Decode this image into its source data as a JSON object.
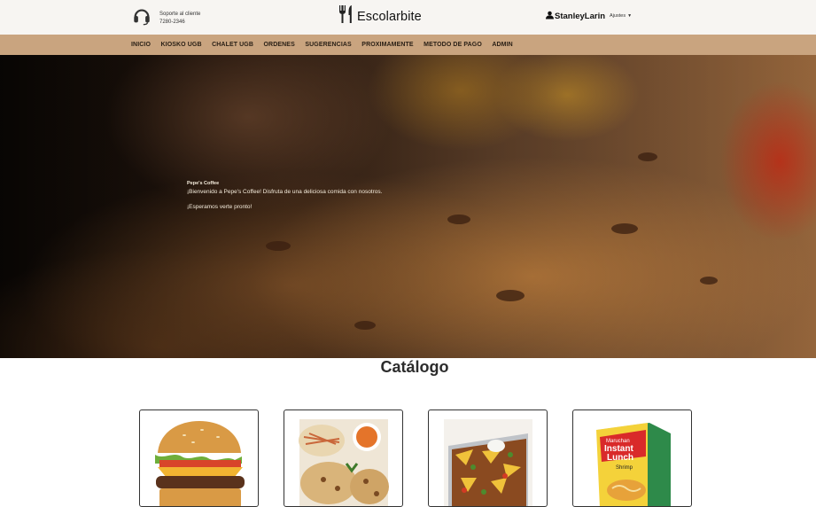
{
  "support": {
    "label": "Soporte al cliente",
    "phone": "7280-2346",
    "icon": "headset-icon"
  },
  "brand": {
    "name": "Escolarbite",
    "icon": "utensils-icon"
  },
  "user": {
    "name": "StanleyLarin",
    "settings_label": "Ajustes",
    "icon": "user-icon"
  },
  "nav": {
    "items": [
      {
        "label": "INICIO"
      },
      {
        "label": "KIOSKO UGB"
      },
      {
        "label": "CHALET UGB"
      },
      {
        "label": "ORDENES"
      },
      {
        "label": "SUGERENCIAS"
      },
      {
        "label": "PROXIMAMENTE"
      },
      {
        "label": "METODO DE PAGO"
      },
      {
        "label": "ADMIN"
      }
    ]
  },
  "hero": {
    "title": "Pepe's Coffee",
    "welcome": "¡Bienvenido a Pepe's Coffee! Disfruta de una deliciosa comida con nosotros.",
    "closing": "¡Esperamos verte pronto!"
  },
  "catalog": {
    "title": "Catálogo",
    "products": [
      {
        "image": "hamburger"
      },
      {
        "image": "pupusas"
      },
      {
        "image": "nachos"
      },
      {
        "image": "instant-noodles",
        "image_text": [
          "Maruchan",
          "Instant",
          "Lunch",
          "Shrimp"
        ]
      }
    ]
  },
  "colors": {
    "nav_background": "#c9a47f",
    "topbar_background": "#f7f5f2"
  }
}
